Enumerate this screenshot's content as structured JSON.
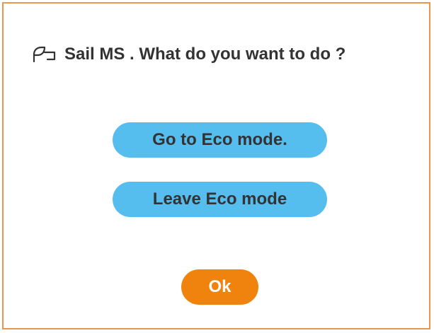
{
  "dialog": {
    "title": "Sail MS . What do you want to do ?",
    "title_icon": "eco-leaf-icon",
    "buttons": {
      "eco_on": "Go to Eco mode.",
      "eco_off": "Leave Eco mode",
      "ok": "Ok"
    }
  },
  "colors": {
    "border": "#e8964a",
    "action_button": "#56bdef",
    "ok_button": "#f0820e",
    "text": "#333333"
  }
}
